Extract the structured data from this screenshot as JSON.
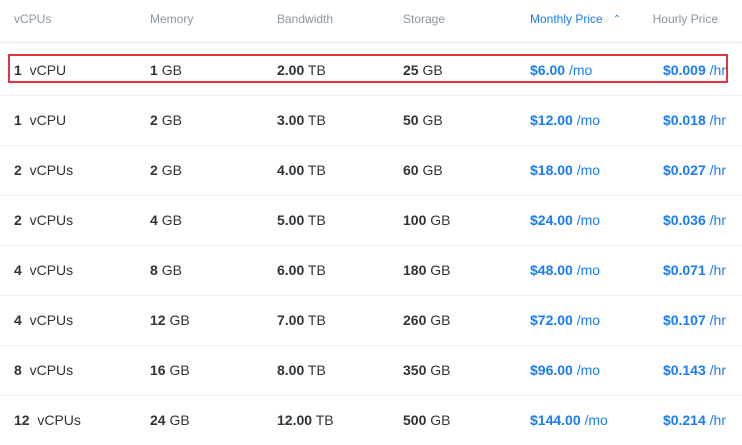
{
  "headers": {
    "vcpus": "vCPUs",
    "memory": "Memory",
    "bandwidth": "Bandwidth",
    "storage": "Storage",
    "monthly_price": "Monthly Price",
    "hourly_price": "Hourly Price",
    "sort_icon": "⌃⌄"
  },
  "rows": [
    {
      "vcpu_num": "1",
      "vcpu_unit": "vCPU",
      "mem_num": "1",
      "mem_unit": "GB",
      "bw_num": "2.00",
      "bw_unit": "TB",
      "st_num": "25",
      "st_unit": "GB",
      "mo_num": "$6.00",
      "mo_unit": "/mo",
      "hr_num": "$0.009",
      "hr_unit": "/hr"
    },
    {
      "vcpu_num": "1",
      "vcpu_unit": "vCPU",
      "mem_num": "2",
      "mem_unit": "GB",
      "bw_num": "3.00",
      "bw_unit": "TB",
      "st_num": "50",
      "st_unit": "GB",
      "mo_num": "$12.00",
      "mo_unit": "/mo",
      "hr_num": "$0.018",
      "hr_unit": "/hr"
    },
    {
      "vcpu_num": "2",
      "vcpu_unit": "vCPUs",
      "mem_num": "2",
      "mem_unit": "GB",
      "bw_num": "4.00",
      "bw_unit": "TB",
      "st_num": "60",
      "st_unit": "GB",
      "mo_num": "$18.00",
      "mo_unit": "/mo",
      "hr_num": "$0.027",
      "hr_unit": "/hr"
    },
    {
      "vcpu_num": "2",
      "vcpu_unit": "vCPUs",
      "mem_num": "4",
      "mem_unit": "GB",
      "bw_num": "5.00",
      "bw_unit": "TB",
      "st_num": "100",
      "st_unit": "GB",
      "mo_num": "$24.00",
      "mo_unit": "/mo",
      "hr_num": "$0.036",
      "hr_unit": "/hr"
    },
    {
      "vcpu_num": "4",
      "vcpu_unit": "vCPUs",
      "mem_num": "8",
      "mem_unit": "GB",
      "bw_num": "6.00",
      "bw_unit": "TB",
      "st_num": "180",
      "st_unit": "GB",
      "mo_num": "$48.00",
      "mo_unit": "/mo",
      "hr_num": "$0.071",
      "hr_unit": "/hr"
    },
    {
      "vcpu_num": "4",
      "vcpu_unit": "vCPUs",
      "mem_num": "12",
      "mem_unit": "GB",
      "bw_num": "7.00",
      "bw_unit": "TB",
      "st_num": "260",
      "st_unit": "GB",
      "mo_num": "$72.00",
      "mo_unit": "/mo",
      "hr_num": "$0.107",
      "hr_unit": "/hr"
    },
    {
      "vcpu_num": "8",
      "vcpu_unit": "vCPUs",
      "mem_num": "16",
      "mem_unit": "GB",
      "bw_num": "8.00",
      "bw_unit": "TB",
      "st_num": "350",
      "st_unit": "GB",
      "mo_num": "$96.00",
      "mo_unit": "/mo",
      "hr_num": "$0.143",
      "hr_unit": "/hr"
    },
    {
      "vcpu_num": "12",
      "vcpu_unit": "vCPUs",
      "mem_num": "24",
      "mem_unit": "GB",
      "bw_num": "12.00",
      "bw_unit": "TB",
      "st_num": "500",
      "st_unit": "GB",
      "mo_num": "$144.00",
      "mo_unit": "/mo",
      "hr_num": "$0.214",
      "hr_unit": "/hr"
    }
  ],
  "colors": {
    "accent": "#1a7cf6",
    "highlight": "#e0353d",
    "header_text": "#8a96a3"
  }
}
